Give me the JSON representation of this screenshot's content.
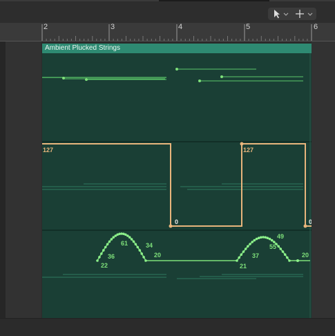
{
  "ruler": {
    "bars": [
      "2",
      "3",
      "4",
      "5",
      "6"
    ]
  },
  "region": {
    "title": "Ambient Plucked Strings"
  },
  "lanes": {
    "velocity_values": [
      "127",
      "0",
      "127",
      "0"
    ],
    "pitch_values": [
      "22",
      "36",
      "61",
      "34",
      "20",
      "21",
      "37",
      "55",
      "49",
      "20"
    ]
  },
  "colors": {
    "region_bg": "#1a3f35",
    "region_header": "#2e8a72",
    "note_green": "#7ee07a",
    "velocity_orange": "#e8b57c"
  },
  "icons": [
    "pointer-tool-icon",
    "chevron-down-icon",
    "crosshair-tool-icon",
    "chevron-down-icon"
  ]
}
